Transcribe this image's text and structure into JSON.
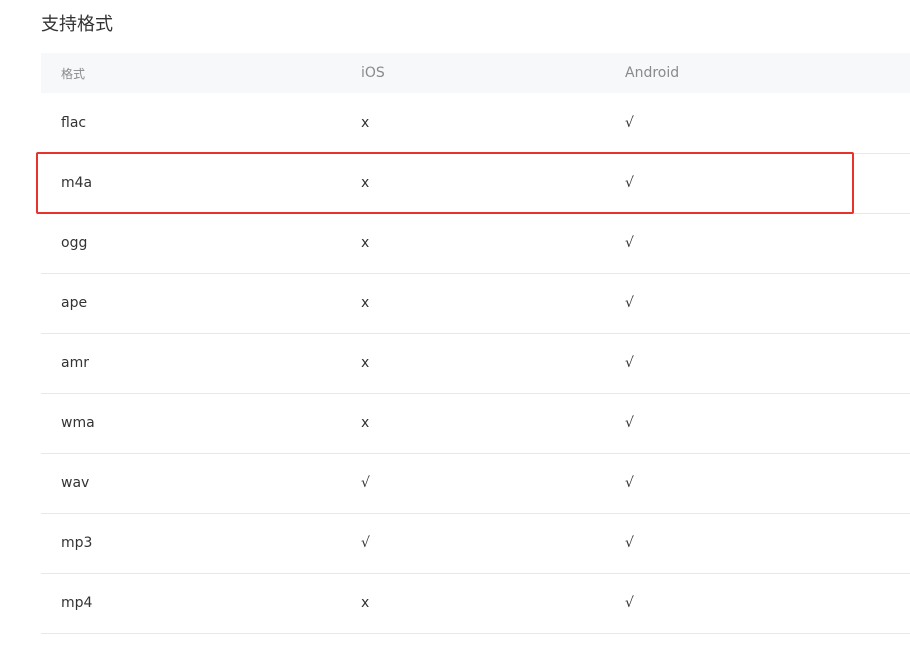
{
  "section_title": "支持格式",
  "table": {
    "headers": [
      "格式",
      "iOS",
      "Android"
    ],
    "rows": [
      {
        "format": "flac",
        "ios": "x",
        "android": "√"
      },
      {
        "format": "m4a",
        "ios": "x",
        "android": "√"
      },
      {
        "format": "ogg",
        "ios": "x",
        "android": "√"
      },
      {
        "format": "ape",
        "ios": "x",
        "android": "√"
      },
      {
        "format": "amr",
        "ios": "x",
        "android": "√"
      },
      {
        "format": "wma",
        "ios": "x",
        "android": "√"
      },
      {
        "format": "wav",
        "ios": "√",
        "android": "√"
      },
      {
        "format": "mp3",
        "ios": "√",
        "android": "√"
      },
      {
        "format": "mp4",
        "ios": "x",
        "android": "√"
      }
    ]
  },
  "highlight": {
    "row_format": "m4a",
    "color": "#e8322c"
  },
  "colors": {
    "header_bg": "#f7f8fa",
    "header_text": "#8a8a8a",
    "body_text": "#333333",
    "row_divider": "#e8e8e8"
  }
}
